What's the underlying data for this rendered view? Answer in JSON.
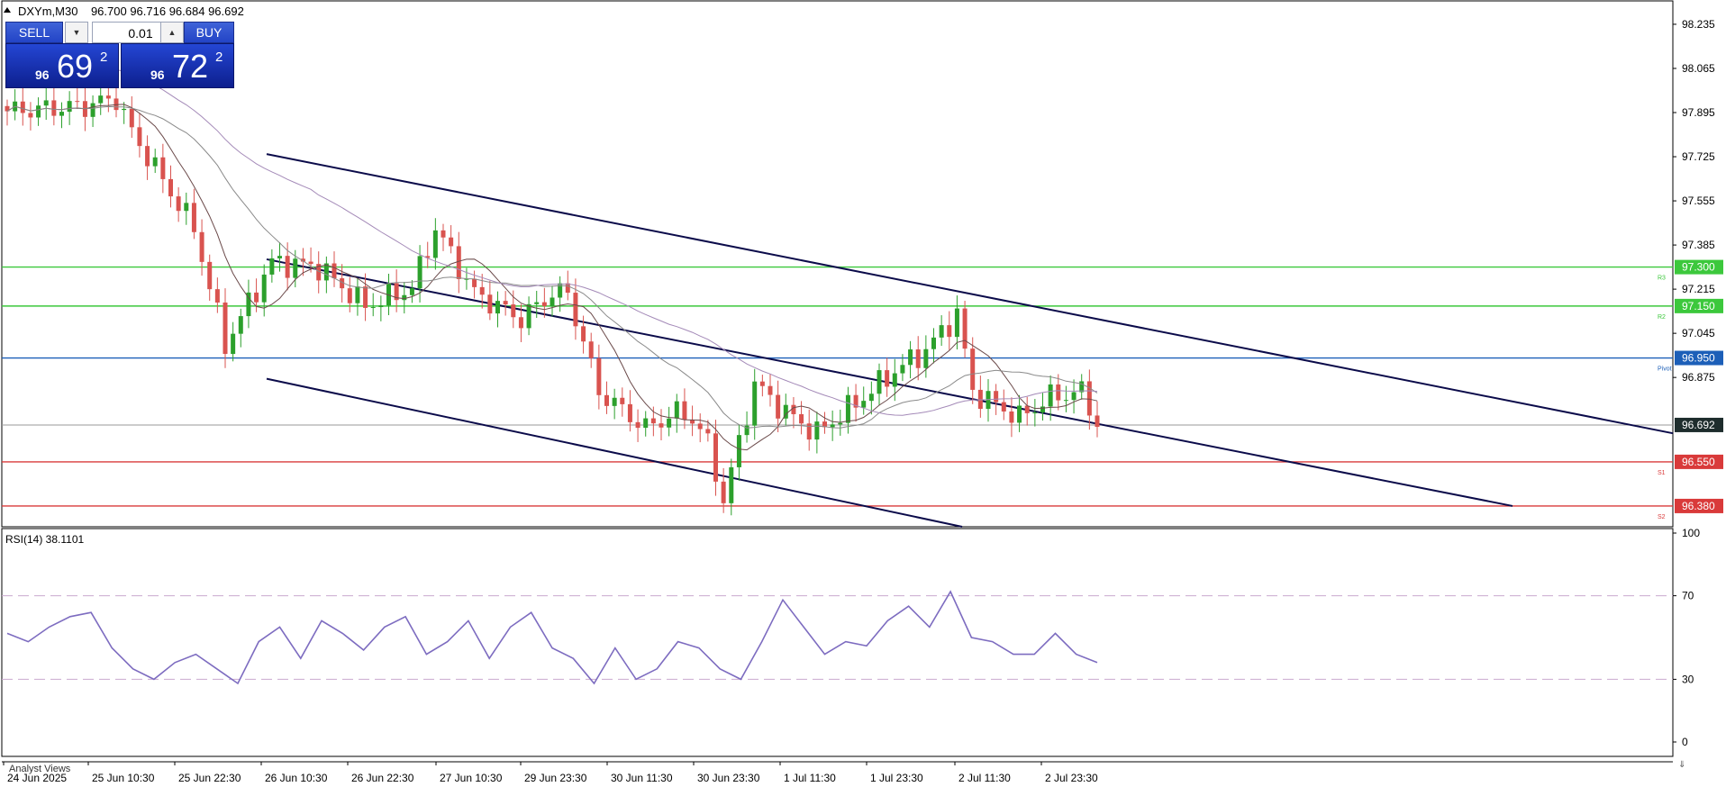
{
  "header": {
    "symbol_timeframe": "DXYm,M30",
    "ohlc": "96.700 96.716 96.684 96.692"
  },
  "trade_panel": {
    "sell_label": "SELL",
    "buy_label": "BUY",
    "volume": "0.01",
    "sell_price": {
      "prefix": "96",
      "big": "69",
      "sup": "2"
    },
    "buy_price": {
      "prefix": "96",
      "big": "72",
      "sup": "2"
    }
  },
  "price_axis": {
    "ticks": [
      "98.235",
      "98.065",
      "97.895",
      "97.725",
      "97.555",
      "97.385",
      "97.215",
      "97.045",
      "96.875"
    ]
  },
  "levels": [
    {
      "price": 97.3,
      "label": "97.300",
      "tag": "R3",
      "color": "#3cc83c"
    },
    {
      "price": 97.15,
      "label": "97.150",
      "tag": "R2",
      "color": "#3cc83c"
    },
    {
      "price": 96.95,
      "label": "96.950",
      "tag": "Pivot",
      "color": "#1c5fb8"
    },
    {
      "price": 96.55,
      "label": "96.550",
      "tag": "S1",
      "color": "#d93a3a"
    },
    {
      "price": 96.38,
      "label": "96.380",
      "tag": "S2",
      "color": "#d93a3a"
    }
  ],
  "current_price": {
    "price": 96.692,
    "label": "96.692",
    "color": "#1e2d2d"
  },
  "rsi": {
    "label": "RSI(14) 38.1101",
    "ticks": [
      "100",
      "70",
      "30",
      "0"
    ],
    "levels": [
      70,
      30
    ],
    "line_color": "#7d6cc0"
  },
  "time_axis": {
    "labels": [
      "24 Jun 2025",
      "25 Jun 10:30",
      "25 Jun 22:30",
      "26 Jun 10:30",
      "26 Jun 22:30",
      "27 Jun 10:30",
      "29 Jun 23:30",
      "30 Jun 11:30",
      "30 Jun 23:30",
      "1 Jul 11:30",
      "1 Jul 23:30",
      "2 Jul 11:30",
      "2 Jul 23:30"
    ]
  },
  "bottom_tab": "Analyst Views",
  "colors": {
    "bull": "#2ca02c",
    "bear": "#d9534f",
    "channel": "#0b0b4a",
    "ma_dark": "#6b4a4a",
    "ma_grey": "#8a8a8a",
    "ma_purple": "#a48ab8"
  },
  "chart_data": {
    "type": "candlestick",
    "instrument": "DXYm",
    "timeframe": "M30",
    "price_range": [
      96.3,
      98.3
    ],
    "series": [
      {
        "name": "Close",
        "x": [
          "24 Jun 2025",
          "25 Jun 10:30",
          "25 Jun 22:30",
          "26 Jun 10:30",
          "26 Jun 22:30",
          "27 Jun 10:30",
          "29 Jun 23:30",
          "30 Jun 11:30",
          "30 Jun 23:30",
          "1 Jul 11:30",
          "1 Jul 23:30",
          "2 Jul 11:30",
          "2 Jul 23:30"
        ],
        "values": [
          97.9,
          97.92,
          97.45,
          97.1,
          97.32,
          97.22,
          97.18,
          97.15,
          96.76,
          96.84,
          96.72,
          96.98,
          96.76
        ]
      }
    ],
    "rsi": {
      "name": "RSI(14)",
      "last": 38.1101,
      "ylim": [
        0,
        100
      ],
      "values": [
        52,
        48,
        55,
        60,
        62,
        45,
        35,
        30,
        38,
        42,
        35,
        28,
        48,
        55,
        40,
        58,
        52,
        44,
        55,
        60,
        42,
        48,
        58,
        40,
        55,
        62,
        45,
        40,
        28,
        45,
        30,
        35,
        48,
        45,
        35,
        30,
        48,
        68,
        55,
        42,
        48,
        46,
        58,
        65,
        55,
        72,
        50,
        48,
        42,
        42,
        52,
        42,
        38
      ]
    },
    "x_labels": [
      "24 Jun 2025",
      "25 Jun 10:30",
      "25 Jun 22:30",
      "26 Jun 10:30",
      "26 Jun 22:30",
      "27 Jun 10:30",
      "29 Jun 23:30",
      "30 Jun 11:30",
      "30 Jun 23:30",
      "1 Jul 11:30",
      "1 Jul 23:30",
      "2 Jul 11:30",
      "2 Jul 23:30"
    ],
    "y_ticks": [
      98.235,
      98.065,
      97.895,
      97.725,
      97.555,
      97.385,
      97.215,
      97.045,
      96.875
    ]
  }
}
